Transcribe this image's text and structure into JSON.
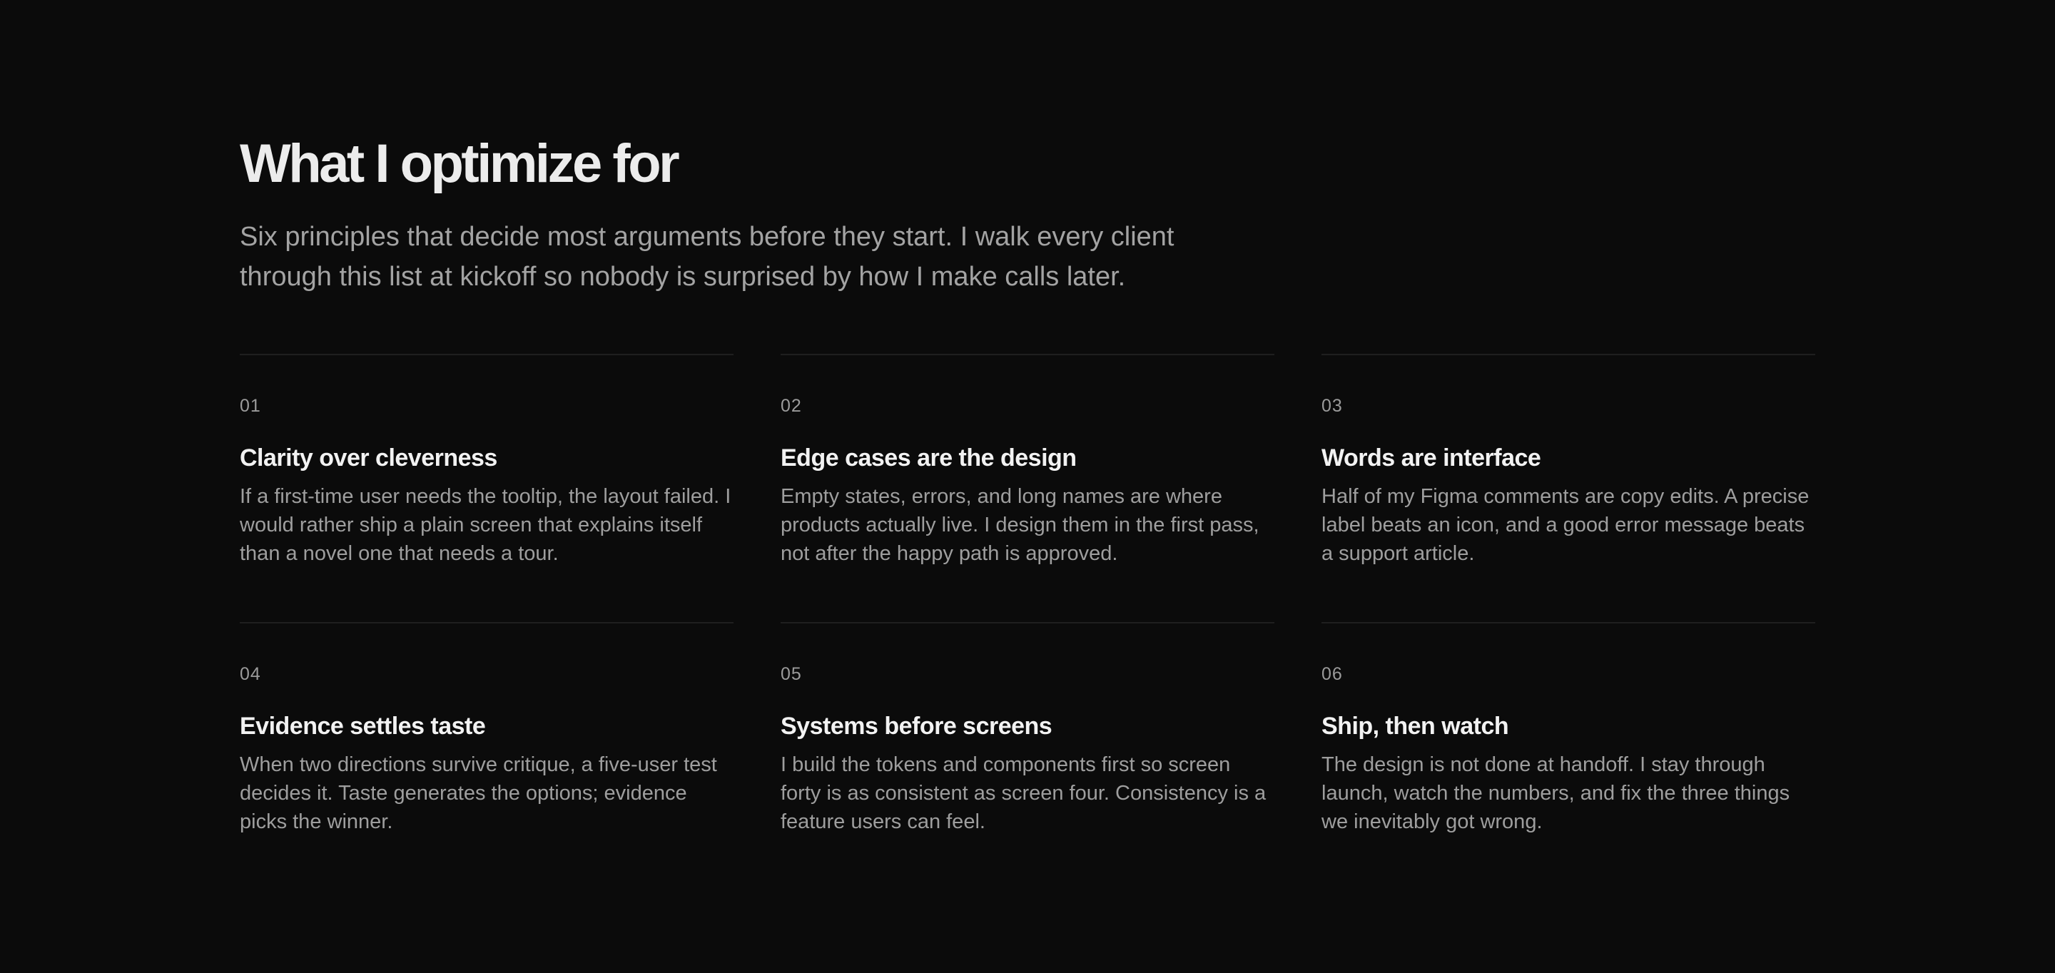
{
  "header": {
    "title": "What I optimize for",
    "intro": "Six principles that decide most arguments before they start. I walk every client through this list at kickoff so nobody is surprised by how I make calls later."
  },
  "principles": [
    {
      "number": "01",
      "title": "Clarity over cleverness",
      "body": "If a first-time user needs the tooltip, the layout failed. I would rather ship a plain screen that explains itself than a novel one that needs a tour."
    },
    {
      "number": "02",
      "title": "Edge cases are the design",
      "body": "Empty states, errors, and long names are where products actually live. I design them in the first pass, not after the happy path is approved."
    },
    {
      "number": "03",
      "title": "Words are interface",
      "body": "Half of my Figma comments are copy edits. A precise label beats an icon, and a good error message beats a support article."
    },
    {
      "number": "04",
      "title": "Evidence settles taste",
      "body": "When two directions survive critique, a five-user test decides it. Taste generates the options; evidence picks the winner."
    },
    {
      "number": "05",
      "title": "Systems before screens",
      "body": "I build the tokens and components first so screen forty is as consistent as screen four. Consistency is a feature users can feel."
    },
    {
      "number": "06",
      "title": "Ship, then watch",
      "body": "The design is not done at handoff. I stay through launch, watch the numbers, and fix the three things we inevitably got wrong."
    }
  ],
  "colors": {
    "background": "#0b0b0b",
    "title": "#ececec",
    "body_text": "#a3a3a3",
    "divider": "#1f1f1f"
  }
}
